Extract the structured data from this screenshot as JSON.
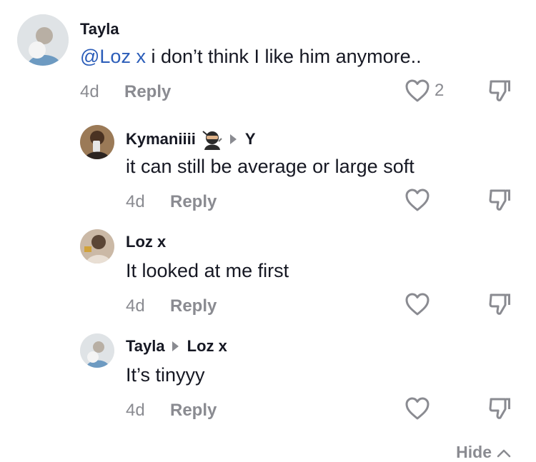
{
  "comments": [
    {
      "author": "Tayla",
      "mention": "@Loz x",
      "text": " i don’t think I like him anymore..",
      "time": "4d",
      "reply_label": "Reply",
      "like_count": "2",
      "avatar_color": "#cfd6dc"
    },
    {
      "author": "Kymaniiii",
      "reply_to": "Y",
      "text": "it can still be average or large soft",
      "time": "4d",
      "reply_label": "Reply",
      "avatar_color": "#7a5a3c"
    },
    {
      "author": "Loz x",
      "text": "It looked at me first",
      "time": "4d",
      "reply_label": "Reply",
      "avatar_color": "#b39a85"
    },
    {
      "author": "Tayla",
      "reply_to": "Loz x",
      "text": "It’s tinyyy",
      "time": "4d",
      "reply_label": "Reply",
      "avatar_color": "#cfd6dc"
    }
  ],
  "hide_label": "Hide",
  "icons": {
    "like": "heart-outline-icon",
    "dislike": "thumbs-down-icon",
    "reply_arrow": "play-triangle-icon",
    "hide": "chevron-up-icon",
    "emoji": "ninja-emoji-icon"
  },
  "colors": {
    "text": "#161823",
    "muted": "#8a8b91",
    "mention": "#2b5db9"
  }
}
